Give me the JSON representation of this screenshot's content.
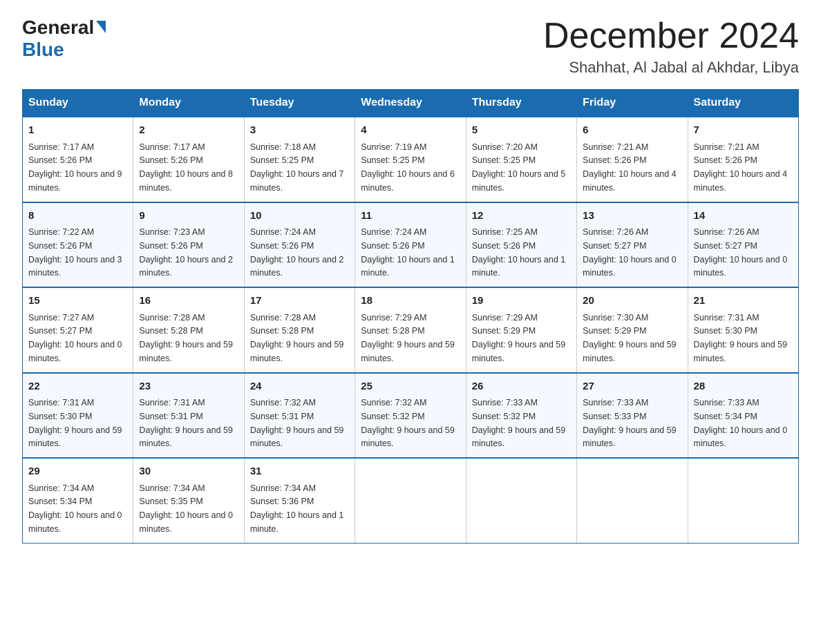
{
  "header": {
    "logo_general": "General",
    "logo_blue": "Blue",
    "month_title": "December 2024",
    "subtitle": "Shahhat, Al Jabal al Akhdar, Libya"
  },
  "days_of_week": [
    "Sunday",
    "Monday",
    "Tuesday",
    "Wednesday",
    "Thursday",
    "Friday",
    "Saturday"
  ],
  "weeks": [
    [
      {
        "day": "1",
        "sunrise": "7:17 AM",
        "sunset": "5:26 PM",
        "daylight": "10 hours and 9 minutes."
      },
      {
        "day": "2",
        "sunrise": "7:17 AM",
        "sunset": "5:26 PM",
        "daylight": "10 hours and 8 minutes."
      },
      {
        "day": "3",
        "sunrise": "7:18 AM",
        "sunset": "5:25 PM",
        "daylight": "10 hours and 7 minutes."
      },
      {
        "day": "4",
        "sunrise": "7:19 AM",
        "sunset": "5:25 PM",
        "daylight": "10 hours and 6 minutes."
      },
      {
        "day": "5",
        "sunrise": "7:20 AM",
        "sunset": "5:25 PM",
        "daylight": "10 hours and 5 minutes."
      },
      {
        "day": "6",
        "sunrise": "7:21 AM",
        "sunset": "5:26 PM",
        "daylight": "10 hours and 4 minutes."
      },
      {
        "day": "7",
        "sunrise": "7:21 AM",
        "sunset": "5:26 PM",
        "daylight": "10 hours and 4 minutes."
      }
    ],
    [
      {
        "day": "8",
        "sunrise": "7:22 AM",
        "sunset": "5:26 PM",
        "daylight": "10 hours and 3 minutes."
      },
      {
        "day": "9",
        "sunrise": "7:23 AM",
        "sunset": "5:26 PM",
        "daylight": "10 hours and 2 minutes."
      },
      {
        "day": "10",
        "sunrise": "7:24 AM",
        "sunset": "5:26 PM",
        "daylight": "10 hours and 2 minutes."
      },
      {
        "day": "11",
        "sunrise": "7:24 AM",
        "sunset": "5:26 PM",
        "daylight": "10 hours and 1 minute."
      },
      {
        "day": "12",
        "sunrise": "7:25 AM",
        "sunset": "5:26 PM",
        "daylight": "10 hours and 1 minute."
      },
      {
        "day": "13",
        "sunrise": "7:26 AM",
        "sunset": "5:27 PM",
        "daylight": "10 hours and 0 minutes."
      },
      {
        "day": "14",
        "sunrise": "7:26 AM",
        "sunset": "5:27 PM",
        "daylight": "10 hours and 0 minutes."
      }
    ],
    [
      {
        "day": "15",
        "sunrise": "7:27 AM",
        "sunset": "5:27 PM",
        "daylight": "10 hours and 0 minutes."
      },
      {
        "day": "16",
        "sunrise": "7:28 AM",
        "sunset": "5:28 PM",
        "daylight": "9 hours and 59 minutes."
      },
      {
        "day": "17",
        "sunrise": "7:28 AM",
        "sunset": "5:28 PM",
        "daylight": "9 hours and 59 minutes."
      },
      {
        "day": "18",
        "sunrise": "7:29 AM",
        "sunset": "5:28 PM",
        "daylight": "9 hours and 59 minutes."
      },
      {
        "day": "19",
        "sunrise": "7:29 AM",
        "sunset": "5:29 PM",
        "daylight": "9 hours and 59 minutes."
      },
      {
        "day": "20",
        "sunrise": "7:30 AM",
        "sunset": "5:29 PM",
        "daylight": "9 hours and 59 minutes."
      },
      {
        "day": "21",
        "sunrise": "7:31 AM",
        "sunset": "5:30 PM",
        "daylight": "9 hours and 59 minutes."
      }
    ],
    [
      {
        "day": "22",
        "sunrise": "7:31 AM",
        "sunset": "5:30 PM",
        "daylight": "9 hours and 59 minutes."
      },
      {
        "day": "23",
        "sunrise": "7:31 AM",
        "sunset": "5:31 PM",
        "daylight": "9 hours and 59 minutes."
      },
      {
        "day": "24",
        "sunrise": "7:32 AM",
        "sunset": "5:31 PM",
        "daylight": "9 hours and 59 minutes."
      },
      {
        "day": "25",
        "sunrise": "7:32 AM",
        "sunset": "5:32 PM",
        "daylight": "9 hours and 59 minutes."
      },
      {
        "day": "26",
        "sunrise": "7:33 AM",
        "sunset": "5:32 PM",
        "daylight": "9 hours and 59 minutes."
      },
      {
        "day": "27",
        "sunrise": "7:33 AM",
        "sunset": "5:33 PM",
        "daylight": "9 hours and 59 minutes."
      },
      {
        "day": "28",
        "sunrise": "7:33 AM",
        "sunset": "5:34 PM",
        "daylight": "10 hours and 0 minutes."
      }
    ],
    [
      {
        "day": "29",
        "sunrise": "7:34 AM",
        "sunset": "5:34 PM",
        "daylight": "10 hours and 0 minutes."
      },
      {
        "day": "30",
        "sunrise": "7:34 AM",
        "sunset": "5:35 PM",
        "daylight": "10 hours and 0 minutes."
      },
      {
        "day": "31",
        "sunrise": "7:34 AM",
        "sunset": "5:36 PM",
        "daylight": "10 hours and 1 minute."
      },
      null,
      null,
      null,
      null
    ]
  ]
}
